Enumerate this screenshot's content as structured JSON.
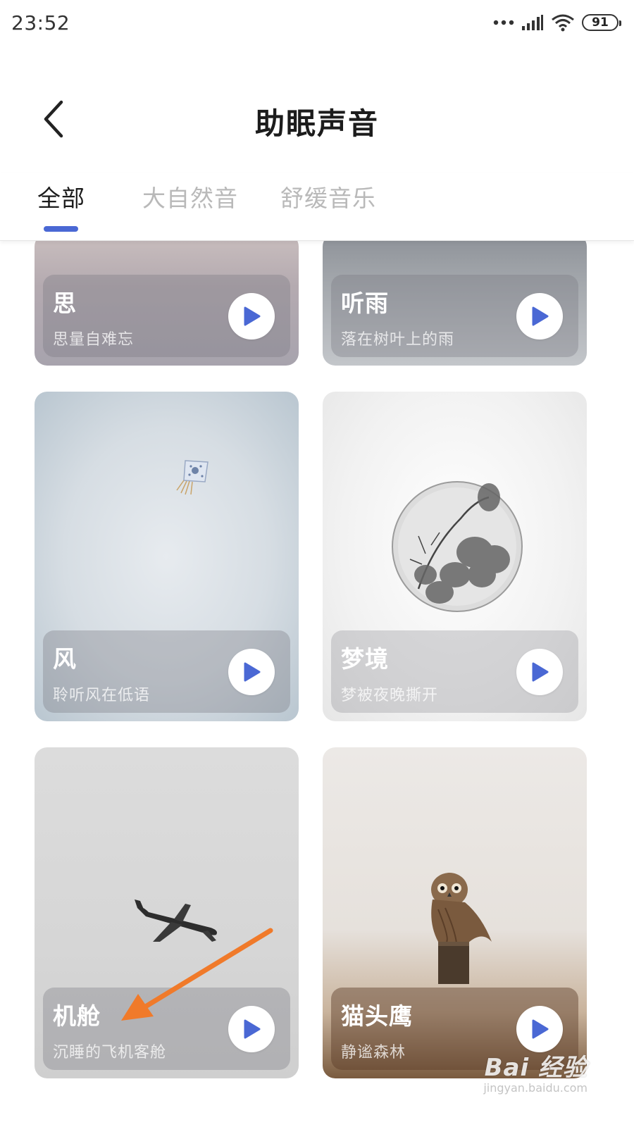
{
  "status_bar": {
    "time": "23:52",
    "battery": "91",
    "icons": [
      "more-dots-icon",
      "signal-icon",
      "wifi-icon",
      "battery-icon"
    ]
  },
  "header": {
    "title": "助眠声音",
    "back_icon": "chevron-left-icon"
  },
  "tabs": [
    {
      "label": "全部",
      "active": true
    },
    {
      "label": "大自然音",
      "active": false
    },
    {
      "label": "舒缓音乐",
      "active": false
    }
  ],
  "accent_color": "#4a68d4",
  "cards": [
    {
      "title": "思",
      "subtitle": "思量自难忘"
    },
    {
      "title": "听雨",
      "subtitle": "落在树叶上的雨"
    },
    {
      "title": "风",
      "subtitle": "聆听风在低语"
    },
    {
      "title": "梦境",
      "subtitle": "梦被夜晚撕开"
    },
    {
      "title": "机舱",
      "subtitle": "沉睡的飞机客舱"
    },
    {
      "title": "猫头鹰",
      "subtitle": "静谧森林"
    }
  ],
  "annotation": {
    "color": "#f07a2a"
  },
  "watermark": {
    "logo": "Bai 经验",
    "url": "jingyan.baidu.com"
  }
}
